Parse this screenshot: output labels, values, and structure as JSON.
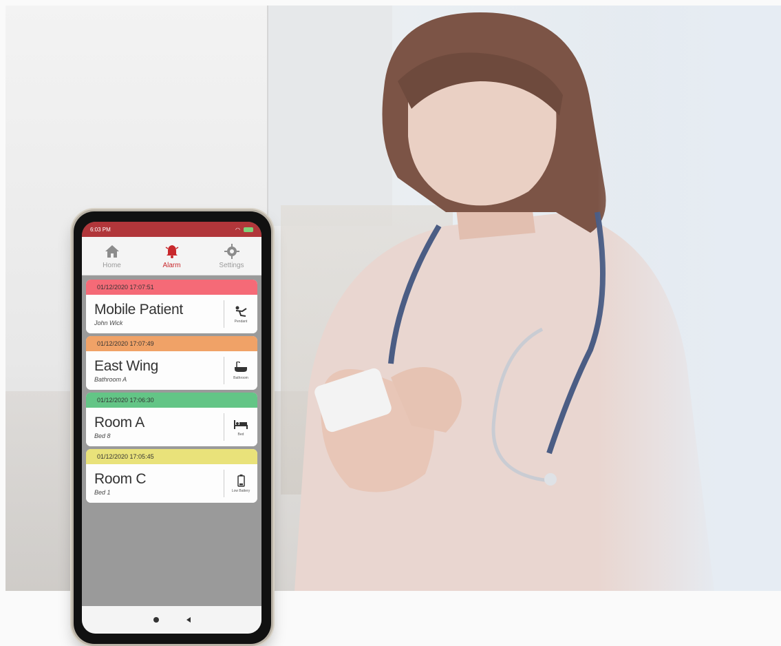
{
  "colors": {
    "status_bar": "#b1363a",
    "accent_red": "#c8282c",
    "alarm_red": "#f56a77",
    "alarm_orange": "#f0a267",
    "alarm_green": "#63c586",
    "alarm_yellow": "#e9e27a"
  },
  "phone": {
    "status_time": "6:03 PM",
    "tabs": [
      {
        "label": "Home",
        "icon": "home-icon",
        "active": false
      },
      {
        "label": "Alarm",
        "icon": "bell-icon",
        "active": true
      },
      {
        "label": "Settings",
        "icon": "gear-icon",
        "active": false
      }
    ],
    "alarms": [
      {
        "timestamp": "01/12/2020 17:07:51",
        "title": "Mobile Patient",
        "subtitle": "John Wick",
        "type_label": "Pendant",
        "icon": "fall-icon",
        "color": "#f56a77"
      },
      {
        "timestamp": "01/12/2020 17:07:49",
        "title": "East Wing",
        "subtitle": "Bathroom A",
        "type_label": "Bathroom",
        "icon": "bathtub-icon",
        "color": "#f0a267"
      },
      {
        "timestamp": "01/12/2020 17:06:30",
        "title": "Room A",
        "subtitle": "Bed 8",
        "type_label": "Bed",
        "icon": "bed-icon",
        "color": "#63c586"
      },
      {
        "timestamp": "01/12/2020 17:05:45",
        "title": "Room C",
        "subtitle": "Bed 1",
        "type_label": "Low Battery",
        "icon": "battery-icon",
        "color": "#e9e27a"
      }
    ]
  }
}
